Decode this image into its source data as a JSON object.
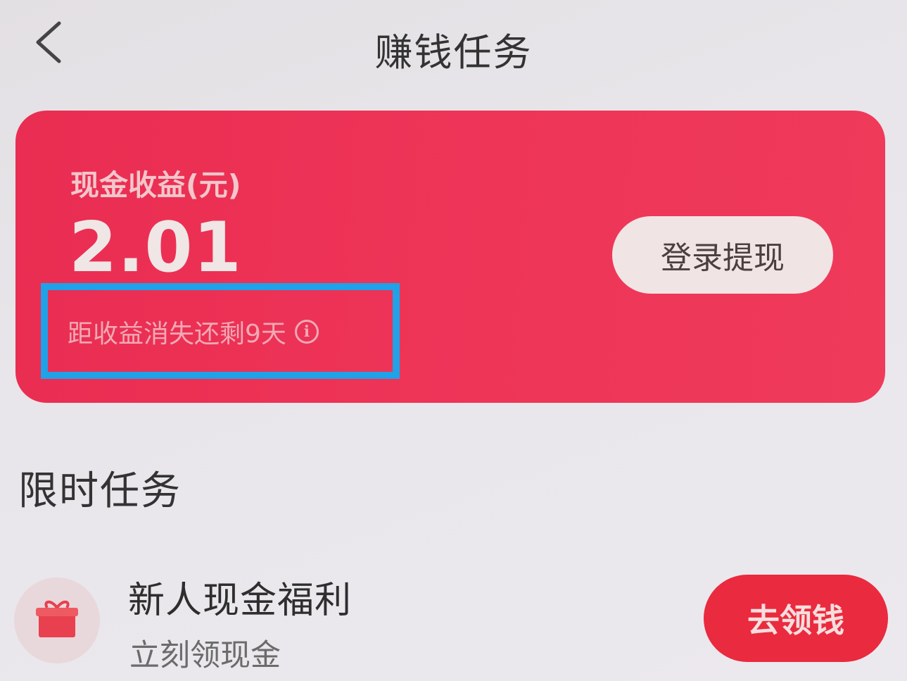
{
  "header": {
    "title": "赚钱任务",
    "back_icon": "chevron-left-icon"
  },
  "earnings_card": {
    "label": "现金收益(元)",
    "amount": "2.01",
    "expire_note": "距收益消失还剩9天",
    "info_icon": "info-icon",
    "withdraw_button": "登录提现",
    "highlight_color": "#1fa2e8",
    "card_color": "#ec3055"
  },
  "limited_tasks": {
    "section_title": "限时任务",
    "items": [
      {
        "icon": "gift-icon",
        "title": "新人现金福利",
        "subtitle": "立刻领现金",
        "button": "去领钱"
      }
    ]
  }
}
